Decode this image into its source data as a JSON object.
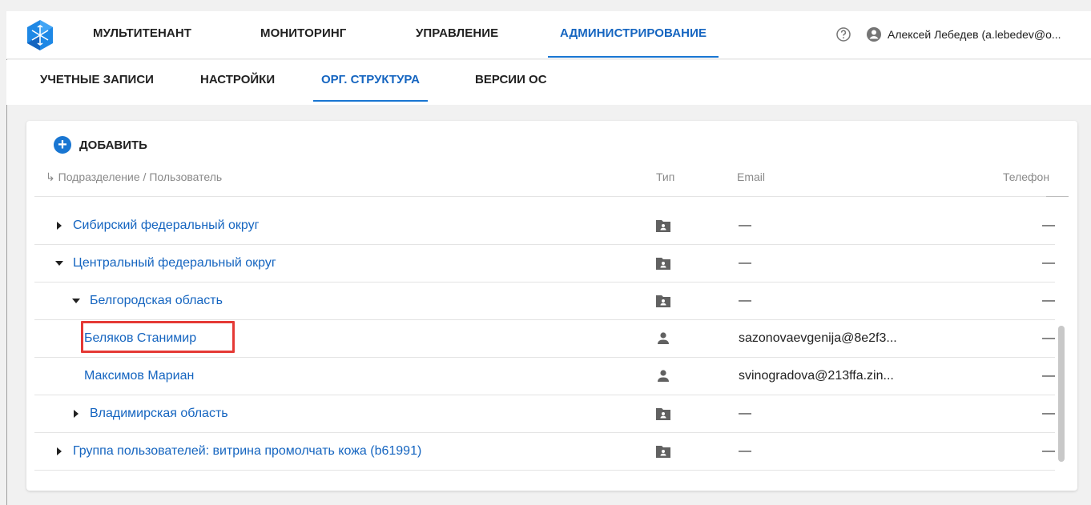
{
  "nav": {
    "tabs": [
      {
        "label": "МУЛЬТИТЕНАНТ"
      },
      {
        "label": "МОНИТОРИНГ"
      },
      {
        "label": "УПРАВЛЕНИЕ"
      },
      {
        "label": "АДМИНИСТРИРОВАНИЕ",
        "active": true
      }
    ],
    "user": "Алексей Лебедев (a.lebedev@o..."
  },
  "subnav": {
    "tabs": [
      {
        "label": "УЧЕТНЫЕ ЗАПИСИ"
      },
      {
        "label": "НАСТРОЙКИ"
      },
      {
        "label": "ОРГ. СТРУКТУРА",
        "active": true
      },
      {
        "label": "ВЕРСИИ ОС"
      }
    ]
  },
  "toolbar": {
    "add_label": "ДОБАВИТЬ"
  },
  "table": {
    "headers": {
      "arrow": "↳",
      "name": "Подразделение / Пользователь",
      "type": "Тип",
      "email": "Email",
      "phone": "Телефон"
    },
    "rows": [
      {
        "name": "Сибирский федеральный округ",
        "level": 0,
        "expander": "collapsed",
        "type_icon": "folder-user-icon",
        "email": "—",
        "phone": "—"
      },
      {
        "name": "Центральный федеральный округ",
        "level": 0,
        "expander": "expanded",
        "type_icon": "folder-user-icon",
        "email": "—",
        "phone": "—"
      },
      {
        "name": "Белгородская область",
        "level": 1,
        "expander": "expanded",
        "type_icon": "folder-user-icon",
        "email": "—",
        "phone": "—"
      },
      {
        "name": "Беляков Станимир",
        "level": 2,
        "expander": "none",
        "type_icon": "person-icon",
        "email": "sazonovaevgenija@8e2f3...",
        "phone": "—",
        "highlighted": true
      },
      {
        "name": "Максимов Мариан",
        "level": 2,
        "expander": "none",
        "type_icon": "person-icon",
        "email": "svinogradova@213ffa.zin...",
        "phone": "—"
      },
      {
        "name": "Владимирская область",
        "level": 1,
        "expander": "collapsed",
        "type_icon": "folder-user-icon",
        "email": "—",
        "phone": "—"
      },
      {
        "name": "Группа пользователей: витрина промолчать кожа (b61991)",
        "level": 0,
        "expander": "collapsed",
        "type_icon": "folder-user-icon",
        "email": "—",
        "phone": "—"
      }
    ]
  },
  "colors": {
    "accent": "#1976d2",
    "link": "#1565c0",
    "highlight": "#e53935"
  }
}
